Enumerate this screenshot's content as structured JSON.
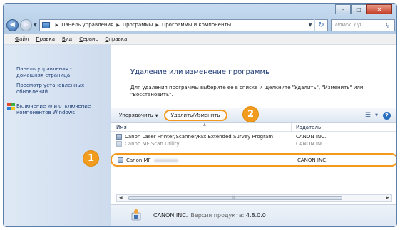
{
  "window": {
    "buttons": {
      "minimize": "–",
      "maximize": "□",
      "close": "✕"
    }
  },
  "address": {
    "crumbs": [
      "Панель управления",
      "Программы",
      "Программы и компоненты"
    ],
    "search_placeholder": "Поиск: Пр..."
  },
  "menu": {
    "items": [
      {
        "accel": "Ф",
        "rest": "айл"
      },
      {
        "accel": "П",
        "rest": "равка"
      },
      {
        "accel": "В",
        "rest": "ид"
      },
      {
        "accel": "С",
        "rest": "ервис"
      },
      {
        "accel": "С",
        "rest": "правка"
      }
    ]
  },
  "sidebar": {
    "home_link": [
      "Панель управления -",
      "домашняя страница"
    ],
    "updates_link": [
      "Просмотр установленных",
      "обновлений"
    ],
    "features_link": [
      "Включение или отключение",
      "компонентов Windows"
    ]
  },
  "main": {
    "heading": "Удаление или изменение программы",
    "description": "Для удаления программы выберите ее в списке и щелкните \"Удалить\", \"Изменить\" или \"Восстановить\"."
  },
  "toolbar": {
    "organize_label": "Упорядочить",
    "uninstall_label": "Удалить/Изменить",
    "view_icon": "list-view-icon",
    "help_label": "?"
  },
  "badges": {
    "first": "1",
    "second": "2"
  },
  "list": {
    "col_name": "Имя",
    "col_publisher": "Издатель",
    "rows": [
      {
        "name": "Canon Laser Printer/Scanner/Fax Extended Survey Program",
        "publisher": "CANON INC."
      },
      {
        "name": "Canon MF Scan Utility",
        "publisher": "CANON INC."
      },
      {
        "name": "Canon MF",
        "publisher": "CANON INC."
      }
    ]
  },
  "details": {
    "publisher": "CANON INC.",
    "version_label": "Версия продукта:",
    "version_value": "4.8.0.0"
  },
  "colors": {
    "highlight": "#f39a1e",
    "link": "#1e3f78"
  }
}
